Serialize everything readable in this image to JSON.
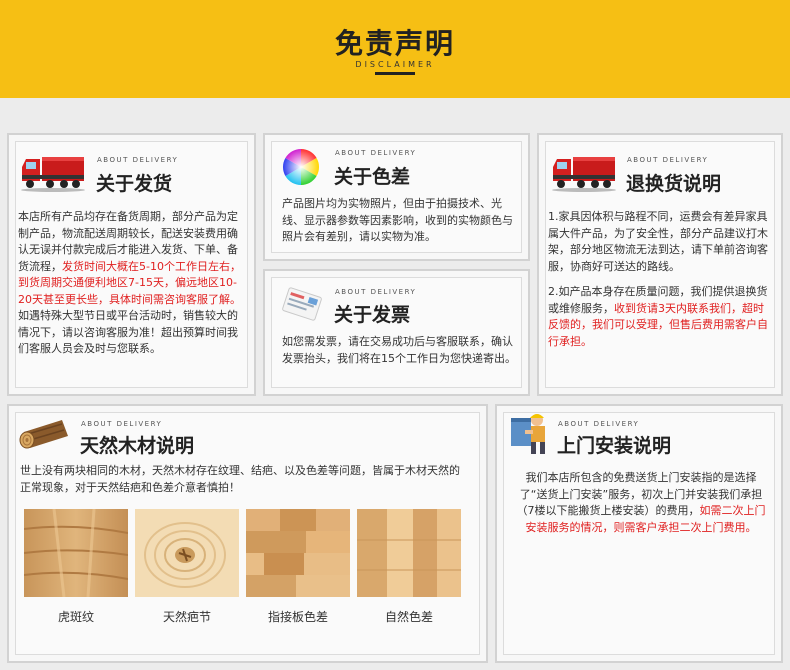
{
  "header": {
    "title": "免责声明",
    "subtitle": "DISCLAIMER"
  },
  "about_label": "ABOUT DELIVERY",
  "delivery": {
    "title": "关于发货",
    "text_a": "本店所有产品均存在备货周期，部分产品为定制产品，物流配送周期较长，配送安装费用确认无误并付款完成后才能进入发货、下单、备货流程，",
    "text_red": "发货时间大概在5-10个工作日左右，到货周期交通便利地区7-15天，偏远地区10-20天甚至更长些，具体时间需咨询客服了解。",
    "text_b": "如遇特殊大型节日或平台活动时，销售较大的情况下，请以咨询客服为准！超出预算时间我们客服人员会及时与您联系。"
  },
  "color_diff": {
    "title": "关于色差",
    "text": "产品图片均为实物照片，但由于拍摄技术、光线、显示器参数等因素影响，收到的实物颜色与照片会有差别，请以实物为准。"
  },
  "invoice": {
    "title": "关于发票",
    "text": "如您需发票，请在交易成功后与客服联系，确认发票抬头，我们将在15个工作日为您快递寄出。"
  },
  "returns": {
    "title": "退换货说明",
    "text1": "1.家具因体积与路程不同，运费会有差异家具属大件产品，为了安全性，部分产品建议打木架，部分地区物流无法到达，请下单前咨询客服，协商好可送达的路线。",
    "text2_a": "2.如产品本身存在质量问题，我们提供退换货或维修服务，",
    "text2_red": "收到货请3天内联系我们，超时反馈的，我们可以受理，但售后费用需客户自行承担。"
  },
  "wood": {
    "title": "天然木材说明",
    "text": "世上没有两块相同的木材，天然木材存在纹理、结疤、以及色差等问题，皆属于木材天然的正常现象，对于天然结疤和色差介意者慎拍！",
    "samples": [
      {
        "label": "虎斑纹"
      },
      {
        "label": "天然疤节"
      },
      {
        "label": "指接板色差"
      },
      {
        "label": "自然色差"
      }
    ]
  },
  "install": {
    "title": "上门安装说明",
    "text_a": "我们本店所包含的免费送货上门安装指的是选择了“送货上门安装”服务，初次上门并安装我们承担（7楼以下能搬货上楼安装）的费用，",
    "text_red": "如需二次上门安装服务的情况，则需客户承担二次上门费用。"
  },
  "colors": {
    "accent": "#f6bf14",
    "highlight_red": "#e02020",
    "background": "#ececec"
  }
}
